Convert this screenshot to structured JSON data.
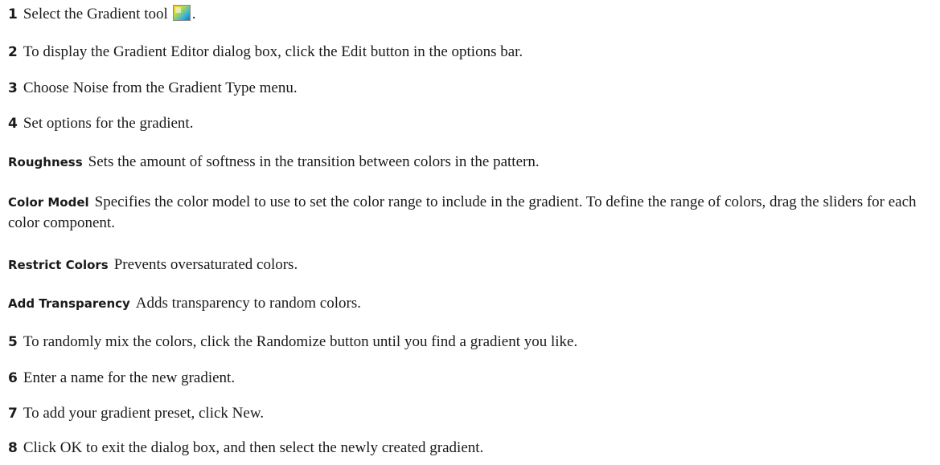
{
  "steps": [
    {
      "num": "1",
      "text": "Select the Gradient tool",
      "suffix": "."
    },
    {
      "num": "2",
      "text": "To display the Gradient Editor dialog box, click the Edit button in the options bar."
    },
    {
      "num": "3",
      "text": "Choose Noise from the Gradient Type menu."
    },
    {
      "num": "4",
      "text": "Set options for the gradient."
    },
    {
      "num": "5",
      "text": "To randomly mix the colors, click the Randomize button until you find a gradient you like."
    },
    {
      "num": "6",
      "text": "Enter a name for the new gradient."
    },
    {
      "num": "7",
      "text": "To add your gradient preset, click New."
    },
    {
      "num": "8",
      "text": "Click OK to exit the dialog box, and then select the newly created gradient."
    }
  ],
  "options": [
    {
      "term": "Roughness",
      "text": "Sets the amount of softness in the transition between colors in the pattern."
    },
    {
      "term": "Color Model",
      "text": "Specifies the color model to use to set the color range to include in the gradient. To define the range of colors, drag the sliders for each color component."
    },
    {
      "term": "Restrict Colors",
      "text": "Prevents oversaturated colors."
    },
    {
      "term": "Add Transparency",
      "text": "Adds transparency to random colors."
    }
  ],
  "icons": {
    "gradient_tool": "gradient-tool-icon"
  }
}
